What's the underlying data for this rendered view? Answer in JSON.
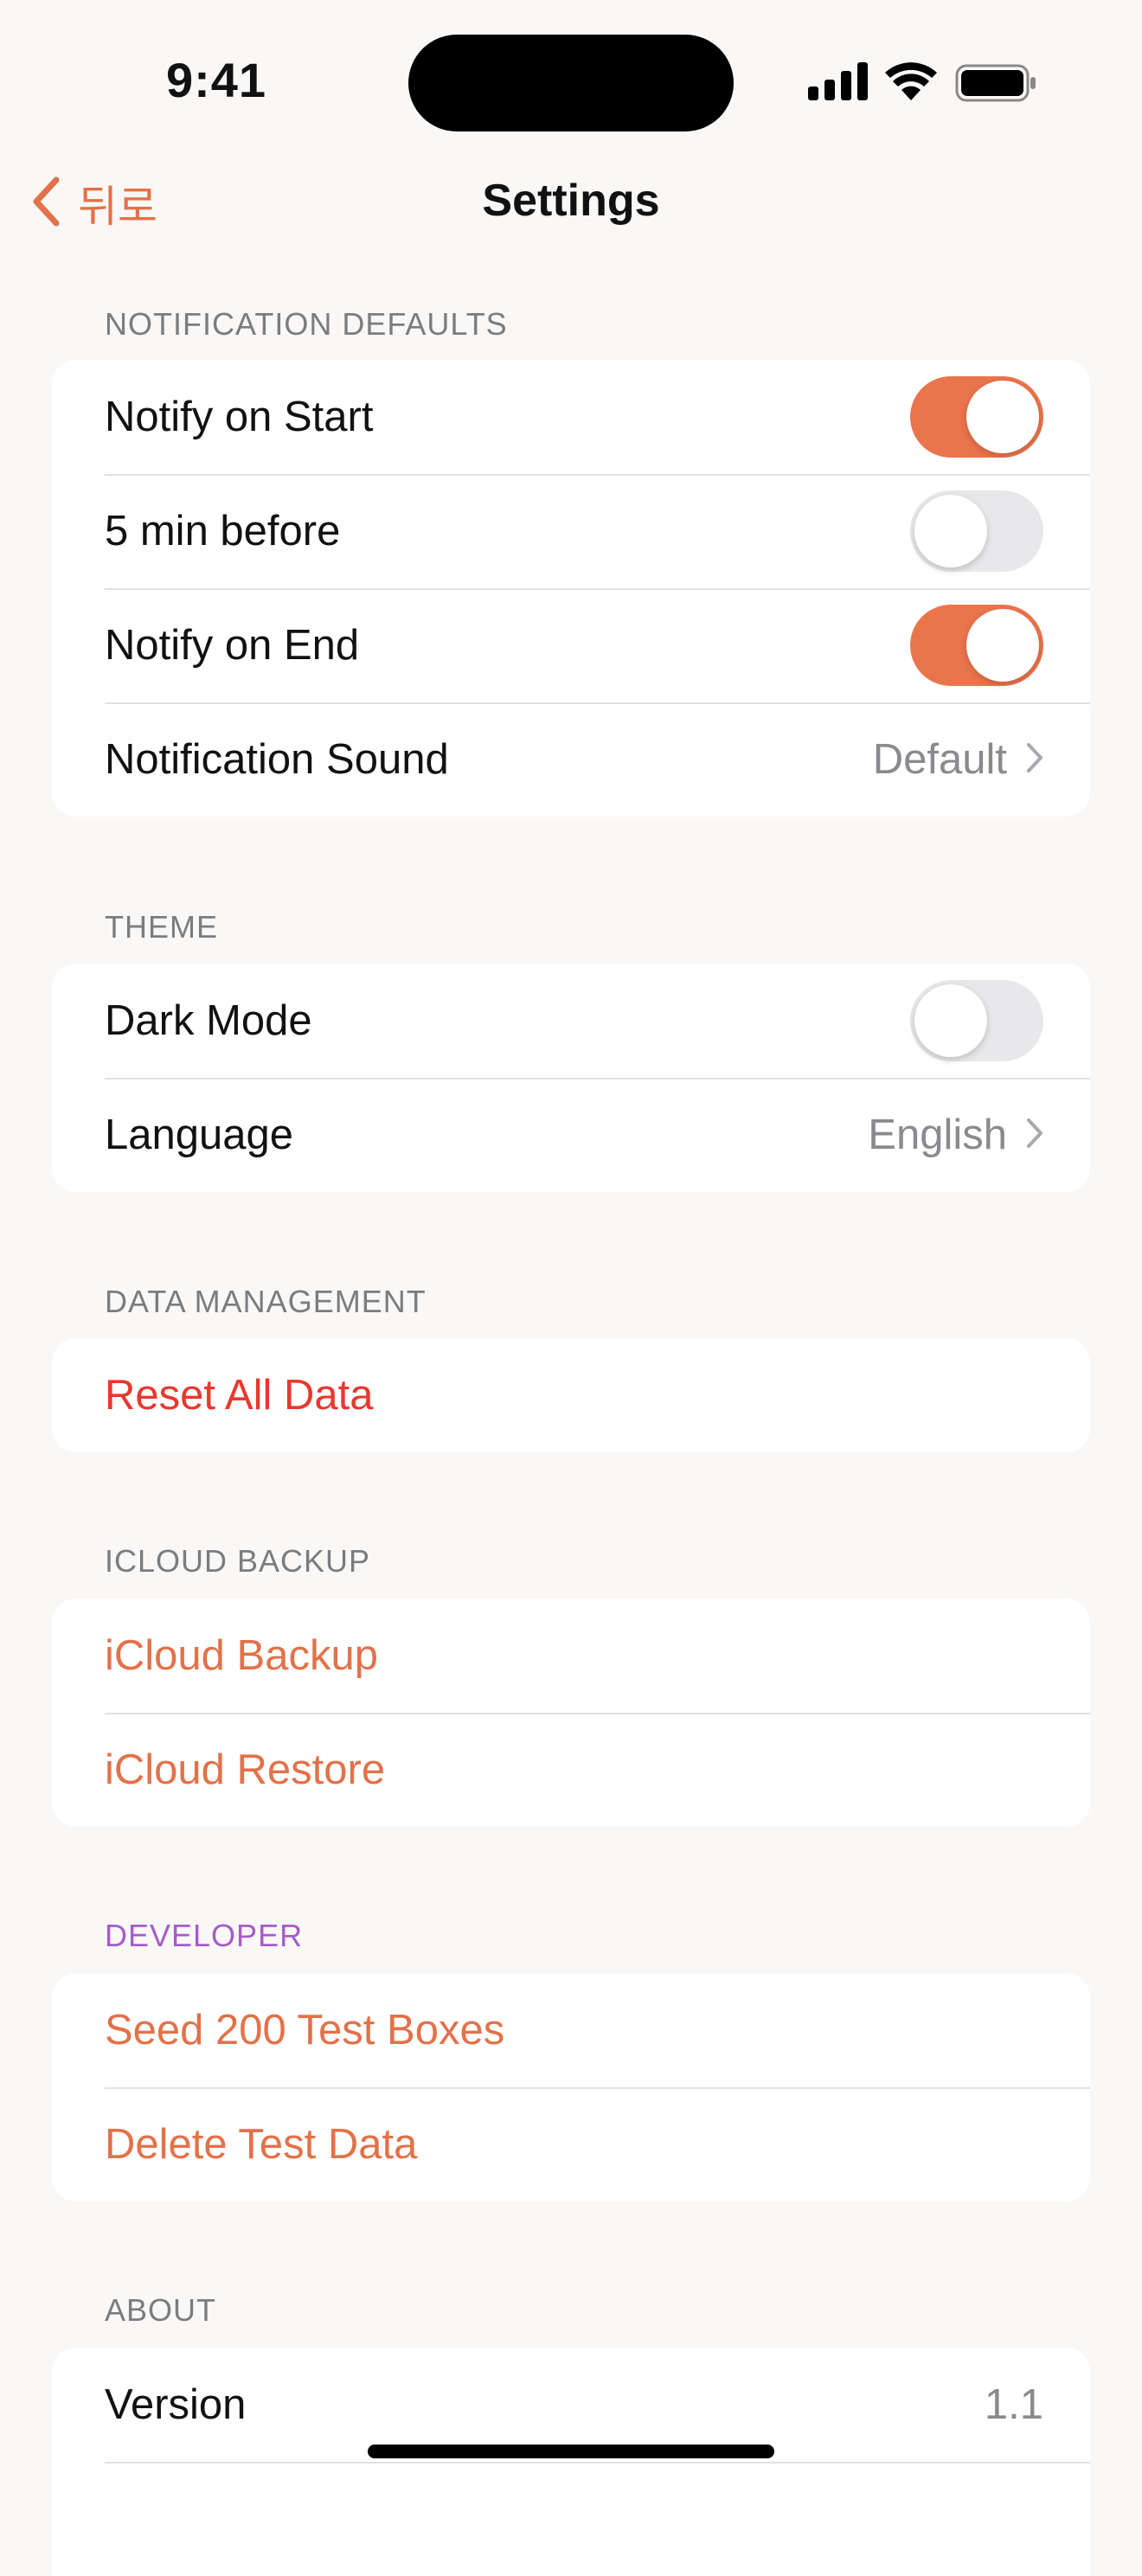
{
  "status_bar": {
    "time": "9:41"
  },
  "nav": {
    "back_label": "뒤로",
    "title": "Settings"
  },
  "sections": {
    "notification_defaults": {
      "header": "NOTIFICATION DEFAULTS",
      "notify_on_start": {
        "label": "Notify on Start",
        "on": true
      },
      "five_min_before": {
        "label": "5 min before",
        "on": false
      },
      "notify_on_end": {
        "label": "Notify on End",
        "on": true
      },
      "notification_sound": {
        "label": "Notification Sound",
        "value": "Default"
      }
    },
    "theme": {
      "header": "THEME",
      "dark_mode": {
        "label": "Dark Mode",
        "on": false
      },
      "language": {
        "label": "Language",
        "value": "English"
      }
    },
    "data_management": {
      "header": "DATA MANAGEMENT",
      "reset_all_data": {
        "label": "Reset All Data"
      }
    },
    "icloud_backup": {
      "header": "ICLOUD BACKUP",
      "backup": {
        "label": "iCloud Backup"
      },
      "restore": {
        "label": "iCloud Restore"
      }
    },
    "developer": {
      "header": "DEVELOPER",
      "seed": {
        "label": "Seed 200 Test Boxes"
      },
      "delete_test_data": {
        "label": "Delete Test Data"
      }
    },
    "about": {
      "header": "ABOUT",
      "version": {
        "label": "Version",
        "value": "1.1"
      }
    }
  },
  "colors": {
    "accent": "#E37149",
    "toggle_on": "#EA744C",
    "toggle_off": "#E8E8EA",
    "destructive": "#E8382E",
    "developer_header": "#A65BCB",
    "background": "#F9F8F6"
  },
  "icons": {
    "back": "chevron-left-icon",
    "disclosure": "chevron-right-icon",
    "signal": "cellular-signal-icon",
    "wifi": "wifi-icon",
    "battery": "battery-icon"
  }
}
